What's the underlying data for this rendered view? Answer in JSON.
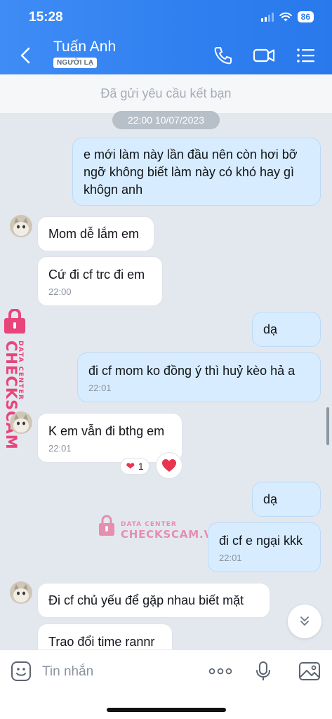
{
  "status_bar": {
    "time": "15:28",
    "battery": "86"
  },
  "header": {
    "contact_name": "Tuấn Anh",
    "badge": "NGƯỜI LẠ"
  },
  "friend_request": {
    "text": "Đã gửi yêu cầu kết bạn"
  },
  "date_separator": "22:00 10/07/2023",
  "messages": [
    {
      "direction": "out",
      "text": "e mới làm này lần đầu nên còn hơi bỡ ngỡ không biết làm này có khó hay gì khôgn anh",
      "time": ""
    },
    {
      "direction": "in",
      "text": "Mom dễ lắm em",
      "time": ""
    },
    {
      "direction": "in",
      "text": "Cứ đi cf trc đi em",
      "time": "22:00"
    },
    {
      "direction": "out",
      "text": "dạ",
      "time": ""
    },
    {
      "direction": "out",
      "text": "đi cf mom ko đồng ý thì huỷ kèo hả a",
      "time": "22:01"
    },
    {
      "direction": "in",
      "text": "K em vẫn đi bthg em",
      "time": "22:01"
    },
    {
      "direction": "out",
      "text": "dạ",
      "time": ""
    },
    {
      "direction": "out",
      "text": "đi cf e ngại kkk",
      "time": "22:01"
    },
    {
      "direction": "in",
      "text": "Đi cf chủ yếu để gặp nhau biết mặt",
      "time": ""
    },
    {
      "direction": "in",
      "text": "Trao đổi time rannr",
      "time": ""
    }
  ],
  "reaction": {
    "emoji": "❤",
    "count": "1"
  },
  "watermark": {
    "brand": "CHECKSCAM.VN",
    "sub": "DATA CENTER"
  },
  "composer": {
    "placeholder": "Tin nhắn"
  },
  "colors": {
    "header": "#2f7ff0",
    "outgoing_bubble": "#d7ecfe",
    "incoming_bubble": "#ffffff",
    "chat_bg": "#e3e8ef",
    "heart": "#e8344e",
    "watermark": "#e8457a"
  }
}
